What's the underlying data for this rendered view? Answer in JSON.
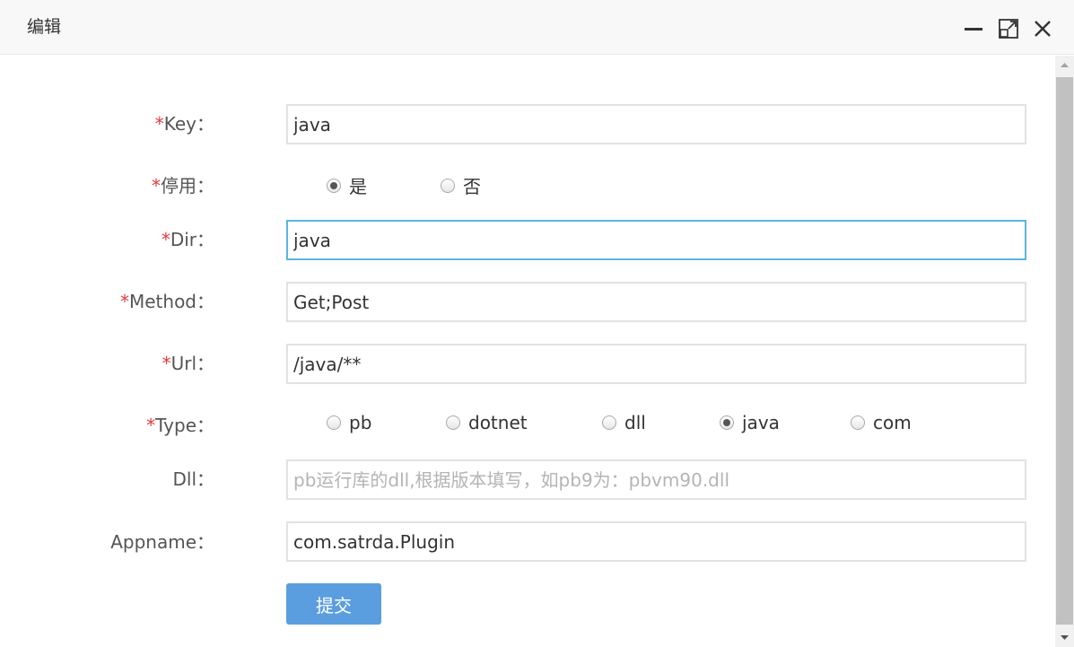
{
  "window": {
    "title": "编辑",
    "icons": [
      "minimize-icon",
      "maximize-icon",
      "close-icon"
    ]
  },
  "form": {
    "required_mark": "*",
    "key": {
      "label": "Key：",
      "value": "java"
    },
    "disabled": {
      "label": "停用：",
      "options": [
        {
          "label": "是",
          "checked": true
        },
        {
          "label": "否",
          "checked": false
        }
      ]
    },
    "dir": {
      "label": "Dir：",
      "value": "java"
    },
    "method": {
      "label": "Method：",
      "value": "Get;Post"
    },
    "url": {
      "label": "Url：",
      "value": "/java/**"
    },
    "type": {
      "label": "Type：",
      "options": [
        {
          "label": "pb",
          "checked": false
        },
        {
          "label": "dotnet",
          "checked": false
        },
        {
          "label": "dll",
          "checked": false
        },
        {
          "label": "java",
          "checked": true
        },
        {
          "label": "com",
          "checked": false
        }
      ]
    },
    "dll": {
      "label": "Dll：",
      "value": "",
      "placeholder": "pb运行库的dll,根据版本填写，如pb9为：pbvm90.dll"
    },
    "appname": {
      "label": "Appname：",
      "value": "com.satrda.Plugin"
    },
    "submit_label": "提交"
  },
  "colors": {
    "accent_button": "#5b9ee0",
    "focus_border": "#5bb6dc",
    "required": "#e4393c"
  }
}
